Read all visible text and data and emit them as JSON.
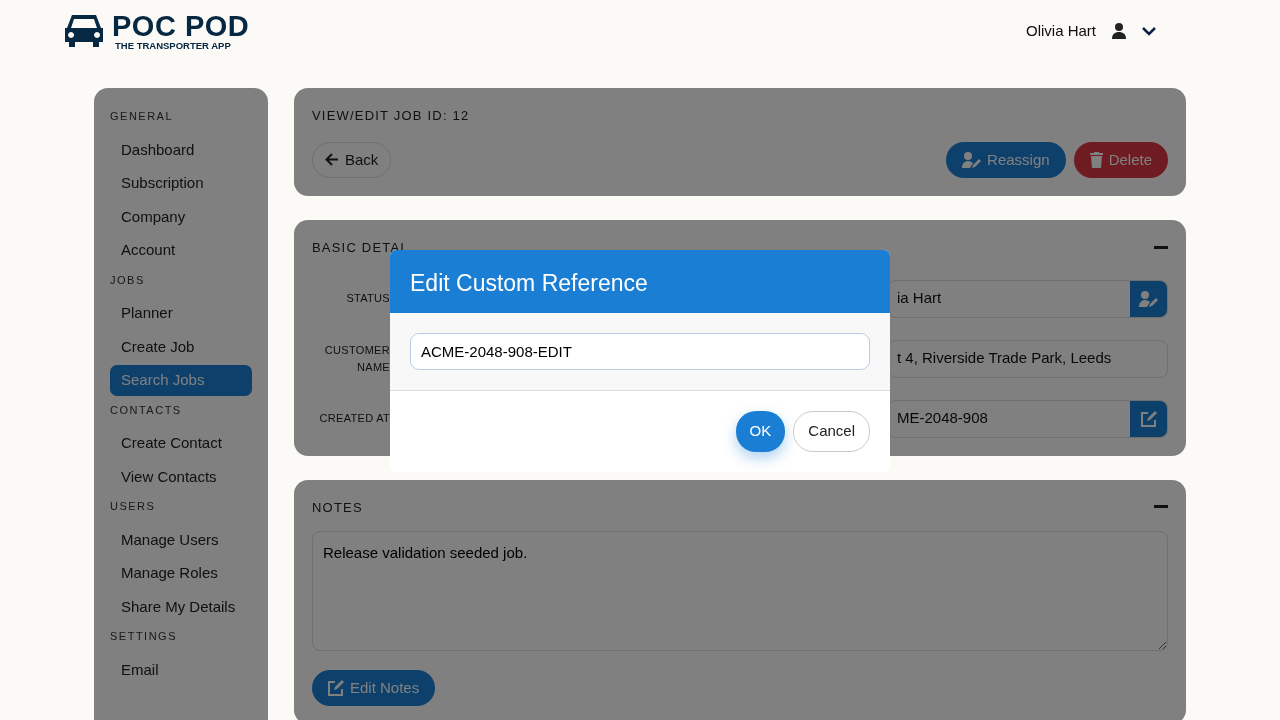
{
  "header": {
    "logo": {
      "title": "POC POD",
      "subtitle": "THE TRANSPORTER APP"
    },
    "user": {
      "name": "Olivia Hart"
    }
  },
  "sidebar": {
    "sections": [
      {
        "heading": "GENERAL",
        "items": [
          {
            "label": "Dashboard",
            "selected": false
          },
          {
            "label": "Subscription",
            "selected": false
          },
          {
            "label": "Company",
            "selected": false
          },
          {
            "label": "Account",
            "selected": false
          }
        ]
      },
      {
        "heading": "JOBS",
        "items": [
          {
            "label": "Planner",
            "selected": false
          },
          {
            "label": "Create Job",
            "selected": false
          },
          {
            "label": "Search Jobs",
            "selected": true
          }
        ]
      },
      {
        "heading": "CONTACTS",
        "items": [
          {
            "label": "Create Contact",
            "selected": false
          },
          {
            "label": "View Contacts",
            "selected": false
          }
        ]
      },
      {
        "heading": "USERS",
        "items": [
          {
            "label": "Manage Users",
            "selected": false
          },
          {
            "label": "Manage Roles",
            "selected": false
          },
          {
            "label": "Share My Details",
            "selected": false
          }
        ]
      },
      {
        "heading": "SETTINGS",
        "items": [
          {
            "label": "Email",
            "selected": false
          }
        ]
      }
    ]
  },
  "job_header": {
    "title": "VIEW/EDIT JOB ID: 12",
    "back_button": "Back",
    "actions": [
      {
        "label": "Reassign",
        "kind": "reassign"
      },
      {
        "label": "Delete",
        "kind": "delete"
      }
    ]
  },
  "basic_details": {
    "title": "BASIC DETAI",
    "rows": [
      {
        "label": "STATUS",
        "value": "ia Hart",
        "kind": "reassign"
      },
      {
        "label": "CUSTOMER NAME",
        "value": "t 4, Riverside Trade Park, Leeds",
        "kind": "plain"
      },
      {
        "label": "CREATED AT",
        "value": "ME-2048-908",
        "kind": "edit"
      }
    ]
  },
  "notes": {
    "title": "NOTES",
    "text": "Release validation seeded job.",
    "button": "Edit Notes"
  },
  "modal": {
    "title": "Edit Custom Reference",
    "value": "ACME-2048-908-EDIT",
    "buttons": [
      {
        "label": "OK",
        "kind": "primary"
      },
      {
        "label": "Cancel",
        "kind": "secondary"
      }
    ]
  }
}
